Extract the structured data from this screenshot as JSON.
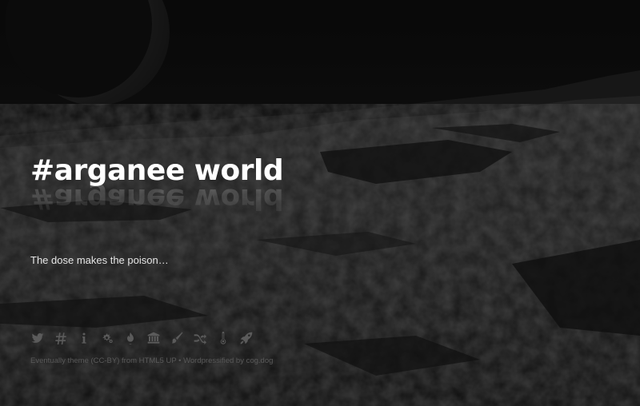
{
  "header": {
    "site_title": "#arganee world",
    "tagline": "The dose makes the poison…"
  },
  "social_icons": [
    {
      "name": "twitter-icon",
      "label": "Twitter"
    },
    {
      "name": "hashtag-icon",
      "label": "Hashtag"
    },
    {
      "name": "info-icon",
      "label": "About"
    },
    {
      "name": "gears-icon",
      "label": "Projects"
    },
    {
      "name": "fire-icon",
      "label": "Fire"
    },
    {
      "name": "bank-icon",
      "label": "Institution"
    },
    {
      "name": "paintbrush-icon",
      "label": "Art"
    },
    {
      "name": "shuffle-icon",
      "label": "Random"
    },
    {
      "name": "thermometer-icon",
      "label": "Temperature"
    },
    {
      "name": "rocket-icon",
      "label": "Rocket"
    }
  ],
  "footer": {
    "credits": "Eventually theme (CC-BY) from HTML5 UP • Wordpressified by cog.dog"
  },
  "colors": {
    "background": "#121212",
    "title": "#ffffff",
    "icon": "#5b5b5b",
    "credits": "#5a5a5a"
  }
}
